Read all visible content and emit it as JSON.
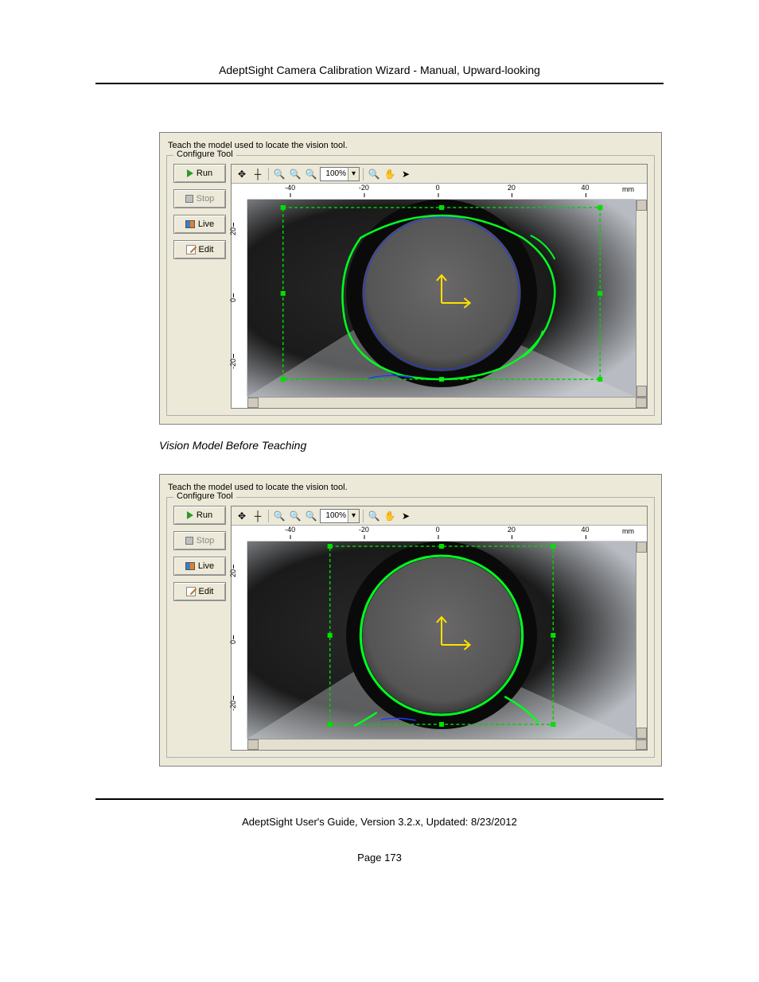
{
  "header_title": "AdeptSight Camera Calibration Wizard - Manual, Upward-looking",
  "panel": {
    "instruction": "Teach the model used to locate the vision tool.",
    "legend": "Configure Tool",
    "buttons": {
      "run": "Run",
      "stop": "Stop",
      "live": "Live",
      "edit": "Edit"
    },
    "toolbar": {
      "zoom_value": "100%",
      "unit": "mm"
    },
    "ruler_x": [
      "-40",
      "-20",
      "0",
      "20",
      "40"
    ],
    "ruler_y": [
      "20",
      "0",
      "-20"
    ]
  },
  "caption1": "Vision Model Before Teaching",
  "footer": "AdeptSight User's Guide,  Version 3.2.x, Updated: 8/23/2012",
  "page_number": "Page 173"
}
